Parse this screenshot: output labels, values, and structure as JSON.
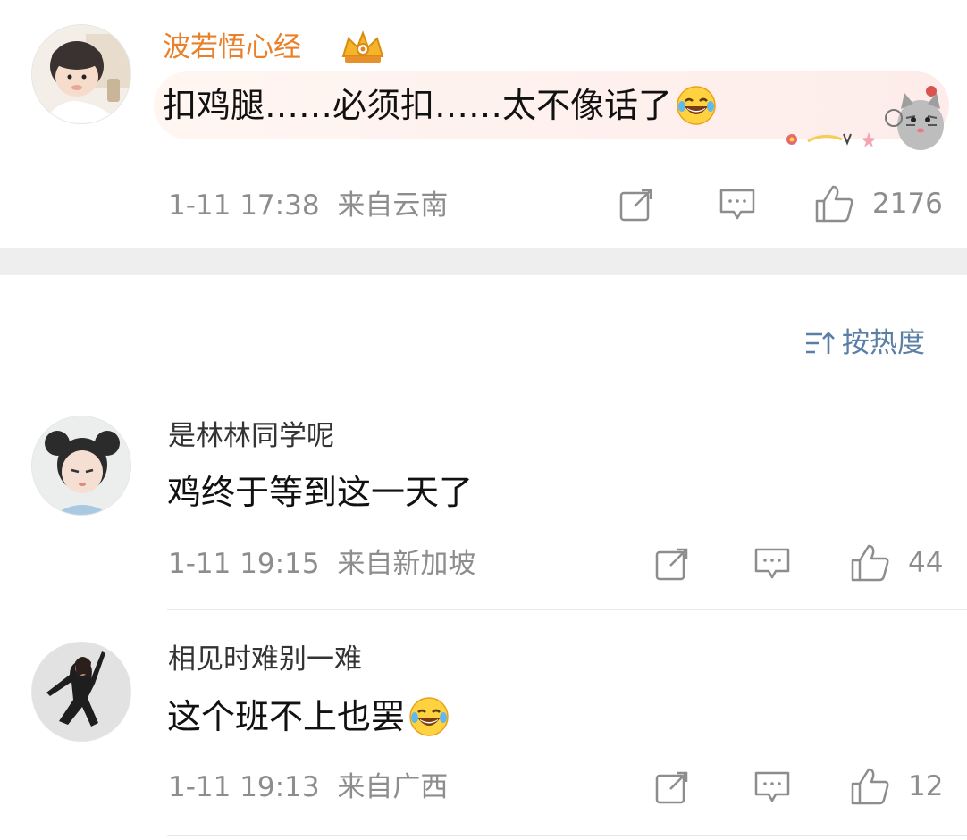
{
  "top_comment": {
    "user": "波若悟心经",
    "text": "扣鸡腿……必须扣……太不像话了",
    "emoji": "laughing-tears-emoji",
    "time": "1-11 17:38",
    "location": "来自云南",
    "likes": "2176"
  },
  "sort": {
    "label": "按热度"
  },
  "comments": [
    {
      "user": "是林林同学呢",
      "text": "鸡终于等到这一天了",
      "time": "1-11 19:15",
      "location": "来自新加坡",
      "likes": "44"
    },
    {
      "user": "相见时难别一难",
      "text": "这个班不上也罢",
      "emoji": "laughing-tears-emoji",
      "time": "1-11 19:13",
      "location": "来自广西",
      "likes": "12"
    }
  ],
  "colors": {
    "vip_name": "#e8812a",
    "link_blue": "#5a7fa6",
    "meta_gray": "#8d8d8d",
    "separator": "#eeeeee"
  },
  "icons": [
    "repost-icon",
    "comment-icon",
    "like-icon",
    "sort-icon",
    "crown-badge-icon",
    "cat-decoration"
  ]
}
